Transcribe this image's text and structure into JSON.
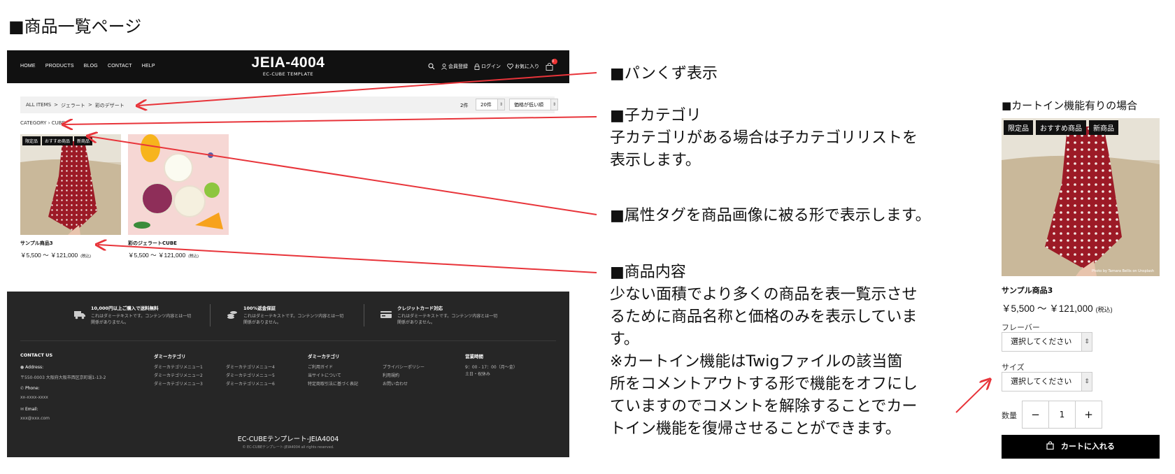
{
  "page_heading": "■商品一覧ページ",
  "shop": {
    "nav": [
      "HOME",
      "PRODUCTS",
      "BLOG",
      "CONTACT",
      "HELP"
    ],
    "brand": "JEIA-4004",
    "brand_sub": "EC-CUBE TEMPLATE",
    "header_links": {
      "register": "会員登録",
      "login": "ログイン",
      "favorite": "お気に入り",
      "cart_count": "0"
    },
    "breadcrumb": [
      "ALL ITEMS",
      "ジェラート",
      "彩のデザート"
    ],
    "separator": ">",
    "count": "2件",
    "per_page": "20件",
    "sort": "価格が低い順",
    "category_label": "CATEGORY",
    "category_value": "CUBE",
    "category_arrow": "›",
    "products": [
      {
        "name": "サンプル商品3",
        "price": "￥5,500 〜 ￥121,000",
        "tax": "(税込)",
        "tags": [
          "限定品",
          "おすすめ商品",
          "新商品"
        ]
      },
      {
        "name": "彩のジェラートCUBE",
        "price": "￥5,500 〜 ￥121,000",
        "tax": "(税込)",
        "tags": []
      }
    ],
    "footer": {
      "features": [
        {
          "title": "10,000円以上ご購入で送料無料",
          "desc": "これはダミーテキストです。コンテンツ内容とは一切関係がありません。"
        },
        {
          "title": "100%返金保証",
          "desc": "これはダミーテキストです。コンテンツ内容とは一切関係がありません。"
        },
        {
          "title": "クレジットカード対応",
          "desc": "これはダミーテキストです。コンテンツ内容とは一切関係がありません。"
        }
      ],
      "contact": {
        "heading": "CONTACT US",
        "address_label": "Address:",
        "address": "〒550-0003 大阪府大阪市西区京町堀1-13-2",
        "phone_label": "Phone:",
        "phone": "xx-xxxx-xxxx",
        "email_label": "Email:",
        "email": "xxx@xxx.com"
      },
      "col1_heading": "ダミーカテゴリ",
      "col1_links": [
        "ダミーカテゴリメニュー1",
        "ダミーカテゴリメニュー2",
        "ダミーカテゴリメニュー3"
      ],
      "col1b_links": [
        "ダミーカテゴリメニュー4",
        "ダミーカテゴリメニュー5",
        "ダミーカテゴリメニュー6"
      ],
      "col2_heading": "ダミーカテゴリ",
      "col2_links": [
        "ご利用ガイド",
        "当サイトについて",
        "特定商取引法に基づく表記"
      ],
      "col2b_links": [
        "プライバシーポリシー",
        "利用規約",
        "お問い合わせ"
      ],
      "hours_heading": "営業時間",
      "hours": [
        "9：00 - 17：00（月〜金）",
        "土日・祝休み"
      ],
      "title": "EC-CUBEテンプレート-JEIA4004",
      "copyright": "© EC-CUBEテンプレート-JEIA4004 all rights reserved."
    }
  },
  "annotations": {
    "breadcrumb": [
      "■パンくず表示"
    ],
    "subcategory": [
      "■子カテゴリ",
      "子カテゴリがある場合は子カテゴリリストを",
      "表示します。"
    ],
    "tags": [
      "■属性タグを商品画像に被る形で表示します。"
    ],
    "content": [
      "■商品内容",
      "少ない面積でより多くの商品を表一覧示させ",
      "るために商品名称と価格のみを表示していま",
      "す。",
      "※カートイン機能はTwigファイルの該当箇",
      "所をコメントアウトする形で機能をオフにし",
      "ていますのでコメントを解除することでカー",
      "トイン機能を復帰させることができます。"
    ]
  },
  "detail": {
    "heading": "■カートイン機能有りの場合",
    "tags": [
      "限定品",
      "おすすめ商品",
      "新商品"
    ],
    "photo_credit": "Photo by Tamara Bellis on Unsplash",
    "name": "サンプル商品3",
    "price": "￥5,500 〜 ￥121,000",
    "tax": "(税込)",
    "flavor_label": "フレーバー",
    "flavor_placeholder": "選択してください",
    "size_label": "サイズ",
    "size_placeholder": "選択してください",
    "qty_label": "数量",
    "qty_minus": "−",
    "qty_value": "1",
    "qty_plus": "+",
    "cart_button": "カートに入れる"
  },
  "colors": {
    "arrow": "#e8343a",
    "header_bg": "#111111",
    "footer_bg": "#262626",
    "tag_bg": "#111111"
  }
}
